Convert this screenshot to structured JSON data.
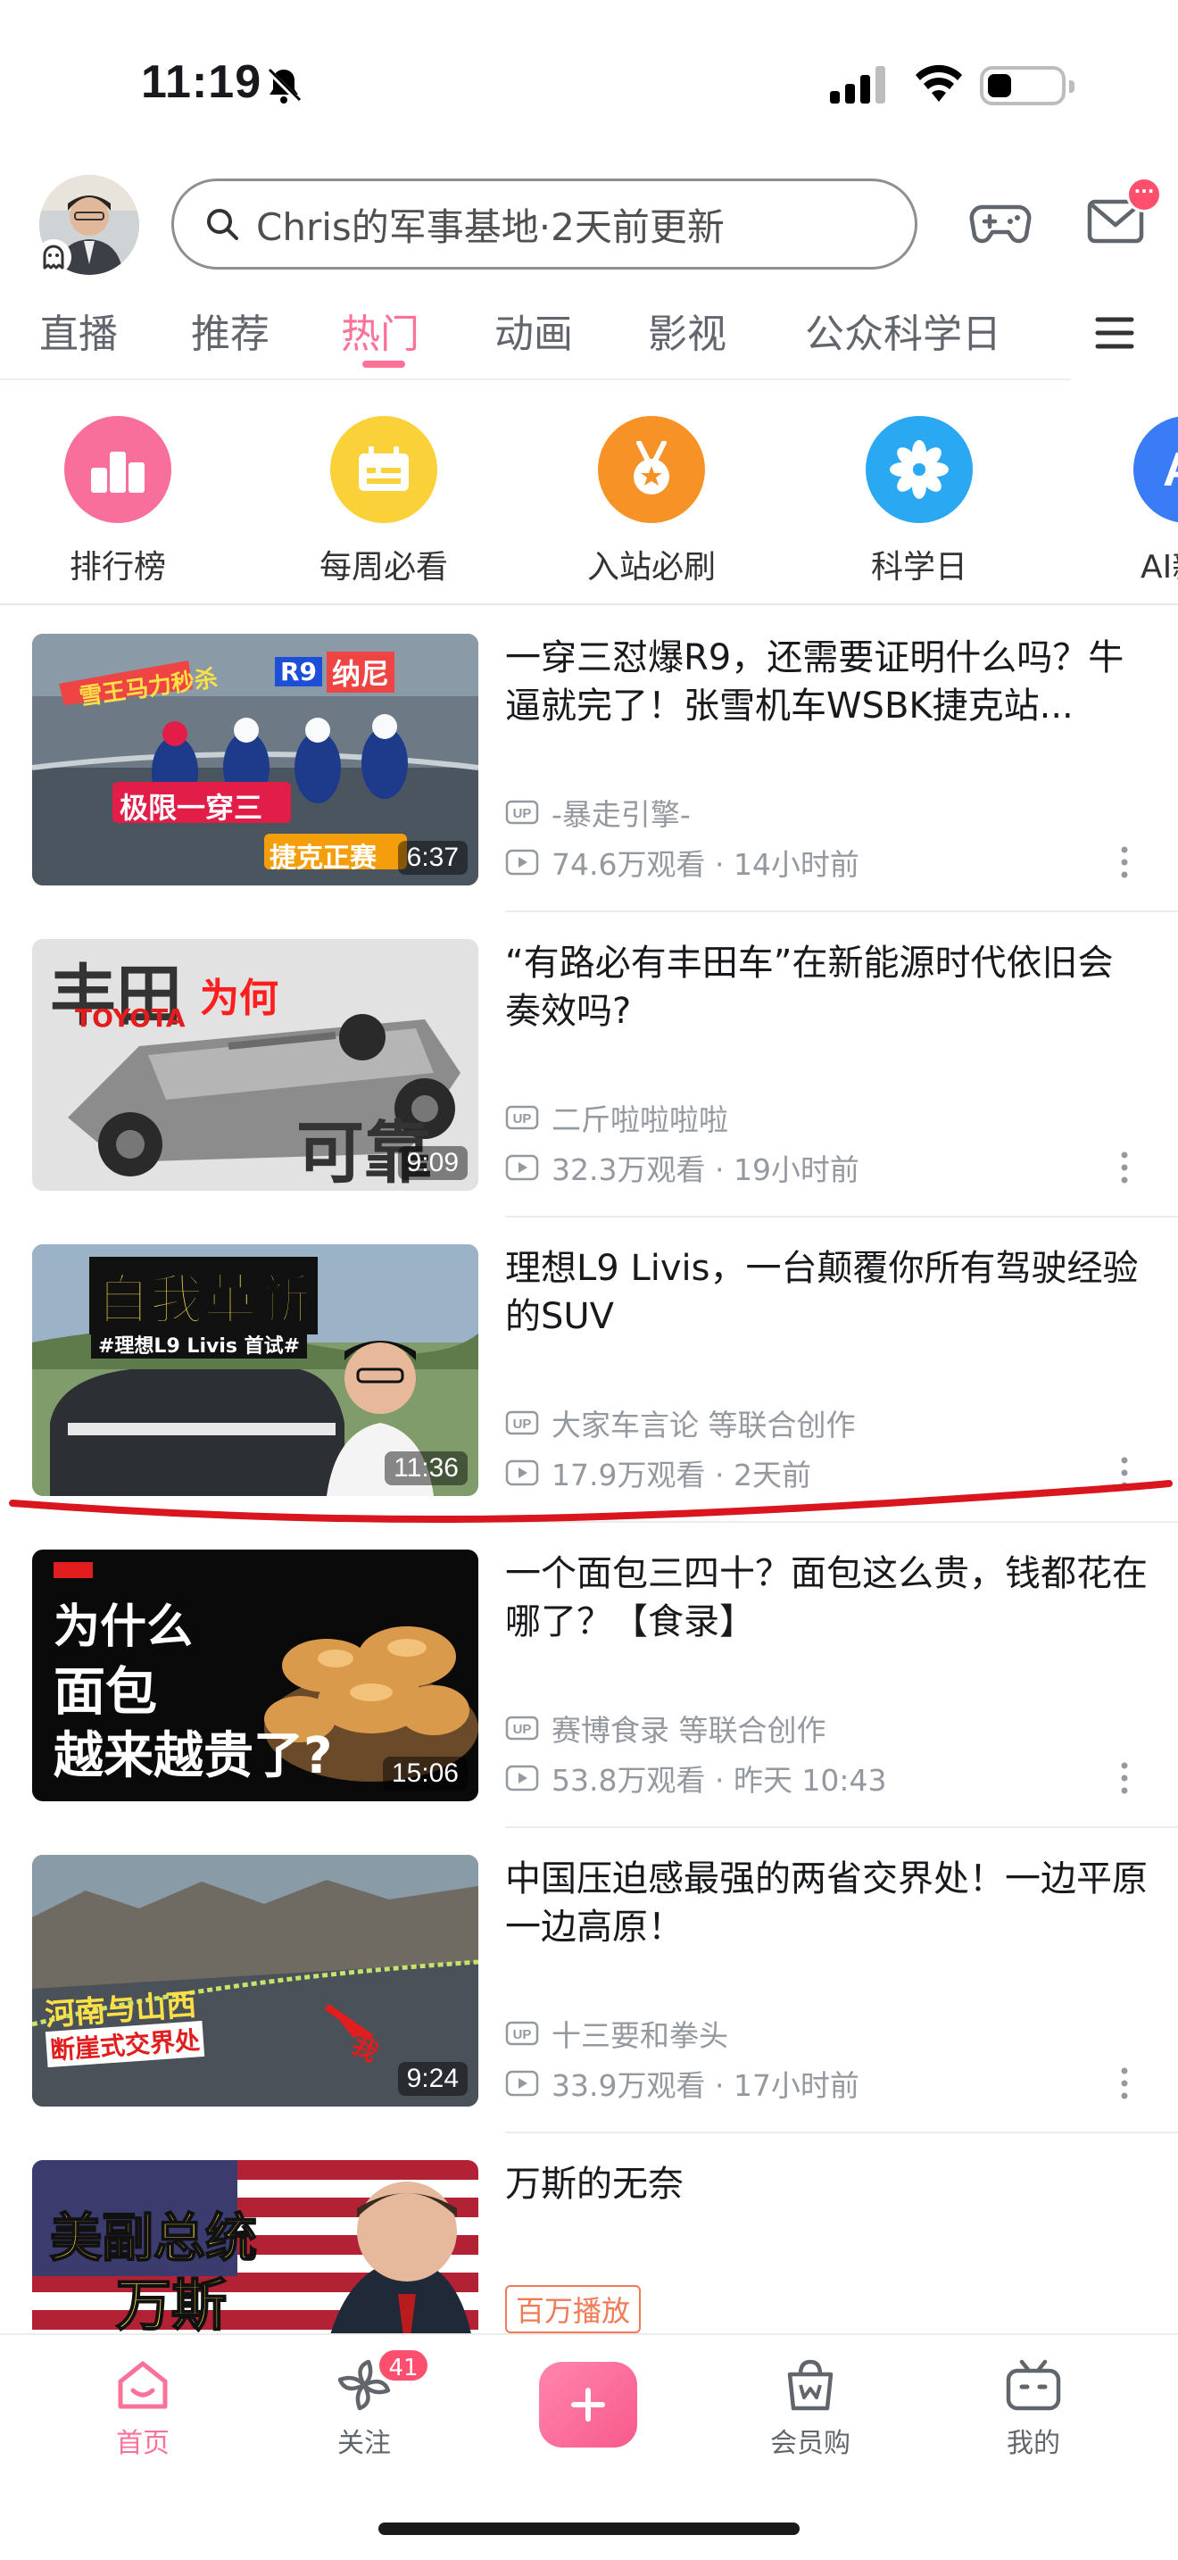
{
  "status_bar": {
    "time": "11:19"
  },
  "header": {
    "search_placeholder": "Chris的军事基地·2天前更新",
    "mail_badge": "···"
  },
  "tabs": [
    {
      "label": "直播"
    },
    {
      "label": "推荐"
    },
    {
      "label": "热门"
    },
    {
      "label": "动画"
    },
    {
      "label": "影视"
    },
    {
      "label": "公众科学日"
    }
  ],
  "quick_entries": [
    {
      "label": "排行榜",
      "color": "#f76f9a"
    },
    {
      "label": "每周必看",
      "color": "#fbd13a"
    },
    {
      "label": "入站必刷",
      "color": "#f79326"
    },
    {
      "label": "科学日",
      "color": "#2aa8f2"
    },
    {
      "label": "AI新",
      "color": "#3a7cf5",
      "glyph": "AI"
    }
  ],
  "feed": [
    {
      "title": "一穿三怼爆R9，还需要证明什么吗？牛逼就完了！张雪机车WSBK捷克站...",
      "uploader": "-暴走引擎-",
      "views": "74.6万观看 · 14小时前",
      "duration": "6:37",
      "thumb_texts": [
        "雪王马力秒杀",
        "R9",
        "纳尼",
        "极限一穿三",
        "捷克正赛"
      ]
    },
    {
      "title": "“有路必有丰田车”在新能源时代依旧会奏效吗?",
      "uploader": "二斤啦啦啦啦",
      "views": "32.3万观看 · 19小时前",
      "duration": "9:09",
      "thumb_texts": [
        "丰田",
        "为何",
        "TOYOTA",
        "可靠"
      ]
    },
    {
      "title": "理想L9 Livis，一台颠覆你所有驾驶经验的SUV",
      "uploader": "大家车言论 等联合创作",
      "views": "17.9万观看 · 2天前",
      "duration": "11:36",
      "thumb_texts": [
        "自我革新",
        "#理想L9 Livis 首试#"
      ]
    },
    {
      "title": "一个面包三四十？面包这么贵，钱都花在哪了？【食录】",
      "uploader": "赛博食录 等联合创作",
      "views": "53.8万观看 · 昨天 10:43",
      "duration": "15:06",
      "thumb_texts": [
        "为什么",
        "面包",
        "越来越贵了?"
      ]
    },
    {
      "title": "中国压迫感最强的两省交界处！一边平原一边高原！",
      "uploader": "十三要和拳头",
      "views": "33.9万观看 · 17小时前",
      "duration": "9:24",
      "thumb_texts": [
        "河南与山西",
        "断崖式交界处",
        "我"
      ]
    },
    {
      "title": "万斯的无奈",
      "tag": "百万播放",
      "thumb_texts": [
        "美副总统",
        "万斯"
      ]
    }
  ],
  "bottom_nav": [
    {
      "label": "首页"
    },
    {
      "label": "关注",
      "badge": "41"
    },
    {
      "label": ""
    },
    {
      "label": "会员购"
    },
    {
      "label": "我的"
    }
  ],
  "colors": {
    "accent": "#fb7299",
    "meta_gray": "#9499a0",
    "annotation_red": "#d9151e"
  }
}
